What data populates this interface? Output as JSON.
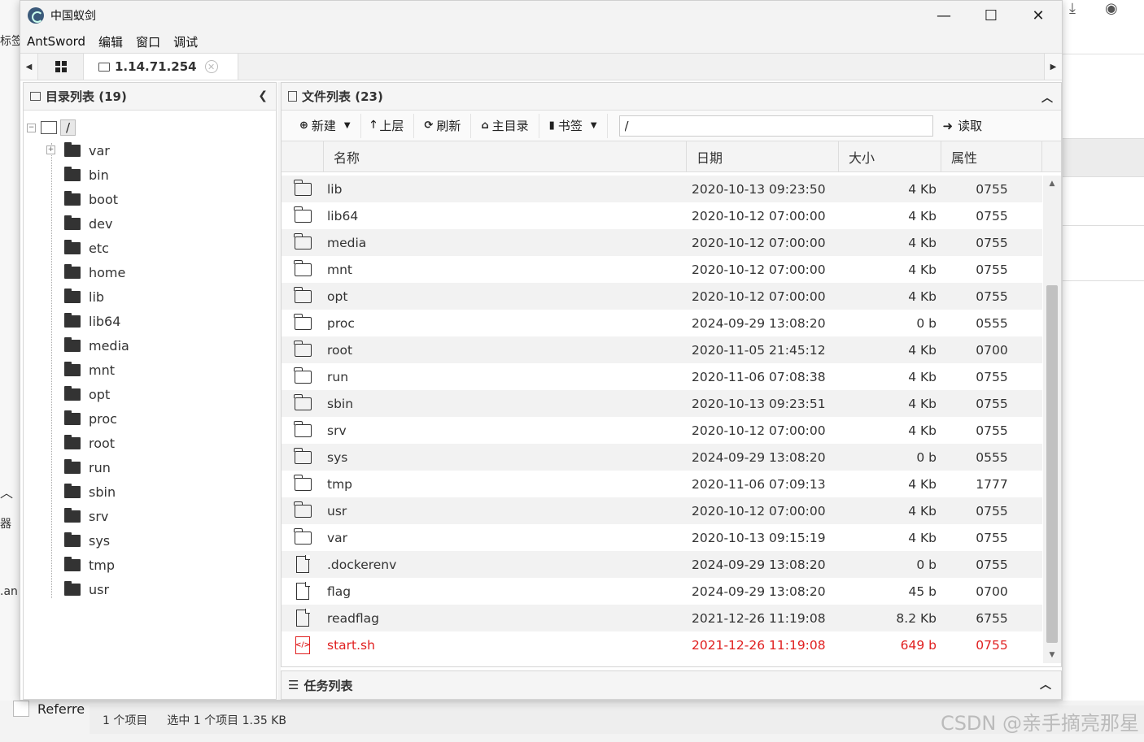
{
  "window": {
    "title": "中国蚁剑",
    "minimize": "—",
    "maximize": "☐",
    "close": "✕"
  },
  "menu": [
    "AntSword",
    "编辑",
    "窗口",
    "调试"
  ],
  "tabs": {
    "active_label": "1.14.71.254",
    "close_glyph": "✕"
  },
  "left_panel": {
    "title": "目录列表 (19)",
    "root": "/",
    "items": [
      "var",
      "bin",
      "boot",
      "dev",
      "etc",
      "home",
      "lib",
      "lib64",
      "media",
      "mnt",
      "opt",
      "proc",
      "root",
      "run",
      "sbin",
      "srv",
      "sys",
      "tmp",
      "usr"
    ]
  },
  "right_panel": {
    "title": "文件列表 (23)",
    "toolbar": {
      "new": "新建",
      "up": "上层",
      "refresh": "刷新",
      "home": "主目录",
      "bookmark": "书签",
      "path_value": "/",
      "read": "读取"
    },
    "columns": [
      "名称",
      "日期",
      "大小",
      "属性"
    ],
    "rows": [
      {
        "icon": "folder",
        "name": "lib",
        "date": "2020-10-13 09:23:50",
        "size": "4 Kb",
        "attr": "0755"
      },
      {
        "icon": "folder",
        "name": "lib64",
        "date": "2020-10-12 07:00:00",
        "size": "4 Kb",
        "attr": "0755"
      },
      {
        "icon": "folder",
        "name": "media",
        "date": "2020-10-12 07:00:00",
        "size": "4 Kb",
        "attr": "0755"
      },
      {
        "icon": "folder",
        "name": "mnt",
        "date": "2020-10-12 07:00:00",
        "size": "4 Kb",
        "attr": "0755"
      },
      {
        "icon": "folder",
        "name": "opt",
        "date": "2020-10-12 07:00:00",
        "size": "4 Kb",
        "attr": "0755"
      },
      {
        "icon": "folder",
        "name": "proc",
        "date": "2024-09-29 13:08:20",
        "size": "0 b",
        "attr": "0555"
      },
      {
        "icon": "folder",
        "name": "root",
        "date": "2020-11-05 21:45:12",
        "size": "4 Kb",
        "attr": "0700"
      },
      {
        "icon": "folder",
        "name": "run",
        "date": "2020-11-06 07:08:38",
        "size": "4 Kb",
        "attr": "0755"
      },
      {
        "icon": "folder",
        "name": "sbin",
        "date": "2020-10-13 09:23:51",
        "size": "4 Kb",
        "attr": "0755"
      },
      {
        "icon": "folder",
        "name": "srv",
        "date": "2020-10-12 07:00:00",
        "size": "4 Kb",
        "attr": "0755"
      },
      {
        "icon": "folder",
        "name": "sys",
        "date": "2024-09-29 13:08:20",
        "size": "0 b",
        "attr": "0555"
      },
      {
        "icon": "folder",
        "name": "tmp",
        "date": "2020-11-06 07:09:13",
        "size": "4 Kb",
        "attr": "1777"
      },
      {
        "icon": "folder",
        "name": "usr",
        "date": "2020-10-12 07:00:00",
        "size": "4 Kb",
        "attr": "0755"
      },
      {
        "icon": "folder",
        "name": "var",
        "date": "2020-10-13 09:15:19",
        "size": "4 Kb",
        "attr": "0755"
      },
      {
        "icon": "file",
        "name": ".dockerenv",
        "date": "2024-09-29 13:08:20",
        "size": "0 b",
        "attr": "0755"
      },
      {
        "icon": "file",
        "name": "flag",
        "date": "2024-09-29 13:08:20",
        "size": "45 b",
        "attr": "0700"
      },
      {
        "icon": "file",
        "name": "readflag",
        "date": "2021-12-26 11:19:08",
        "size": "8.2 Kb",
        "attr": "6755"
      },
      {
        "icon": "code-file",
        "name": "start.sh",
        "date": "2021-12-26 11:19:08",
        "size": "649 b",
        "attr": "0755",
        "highlight": "#e02020"
      }
    ]
  },
  "task_panel": {
    "title": "任务列表"
  },
  "background": {
    "status_items": [
      "1 个项目",
      "选中 1 个项目  1.35 KB"
    ],
    "referrer": "Referre",
    "left_fragments": [
      "标签",
      "器",
      ".an"
    ],
    "watermark": "CSDN @亲手摘亮那星"
  }
}
